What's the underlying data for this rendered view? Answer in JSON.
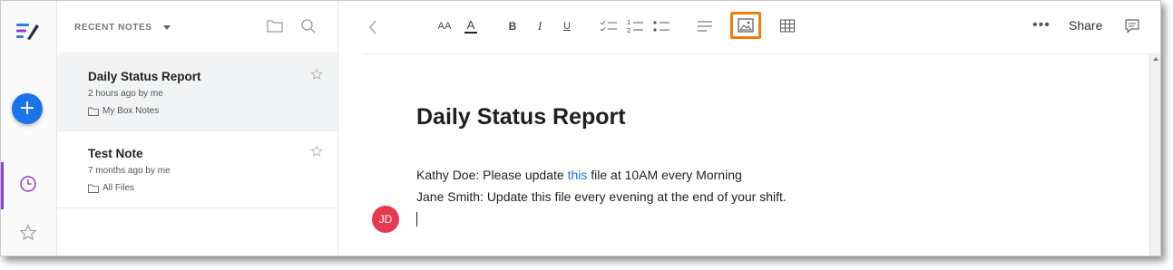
{
  "sidebar": {
    "add_label": "+",
    "recent_icon": "clock-icon",
    "favorites_icon": "star-icon"
  },
  "notes_panel": {
    "header_title": "RECENT NOTES",
    "notes": [
      {
        "title": "Daily Status Report",
        "time": "2 hours ago by me",
        "folder": "My Box Notes"
      },
      {
        "title": "Test Note",
        "time": "7 months ago by me",
        "folder": "All Files"
      }
    ]
  },
  "toolbar": {
    "font_size_label": "AA",
    "text_color_label": "A",
    "bold_label": "B",
    "italic_label": "I",
    "underline_label": "U",
    "more_label": "•••",
    "share_label": "Share",
    "highlight_color": "#f57c00"
  },
  "document": {
    "title": "Daily Status Report",
    "line1_prefix": "Kathy Doe: Please update ",
    "line1_link": "this",
    "line1_suffix": " file at 10AM every Morning",
    "line2": "Jane Smith: Update this file every evening at the end of your shift.",
    "avatar_initials": "JD"
  }
}
